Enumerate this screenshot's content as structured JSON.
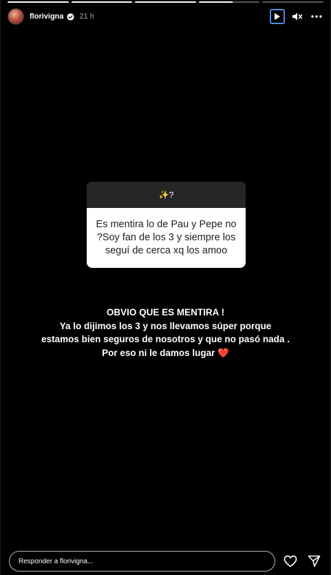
{
  "story": {
    "progress": [
      1,
      1,
      1,
      0.55,
      0
    ],
    "username": "florivigna",
    "time": "21 h"
  },
  "question_box": {
    "header": "✨?",
    "question": "Es mentira lo de Pau y Pepe no ?Soy fan de los 3 y siempre los seguí de cerca xq los amoo"
  },
  "answer": {
    "lines": [
      "OBVIO QUE ES MENTIRA !",
      "Ya lo dijimos los 3 y nos llevamos súper porque",
      "estamos bien seguros de nosotros y que no pasó nada .",
      "Por eso ni le damos lugar"
    ],
    "heart": "❤️"
  },
  "footer": {
    "reply_placeholder": "Responder a florivigna..."
  },
  "icons": {
    "verified": "verified-badge-icon",
    "play": "play-icon",
    "mute": "mute-icon",
    "more": "more-icon",
    "like": "heart-icon",
    "share": "send-icon"
  },
  "colors": {
    "background": "#000000",
    "accent_focus": "#4a90e2",
    "heart": "#e0212b"
  }
}
